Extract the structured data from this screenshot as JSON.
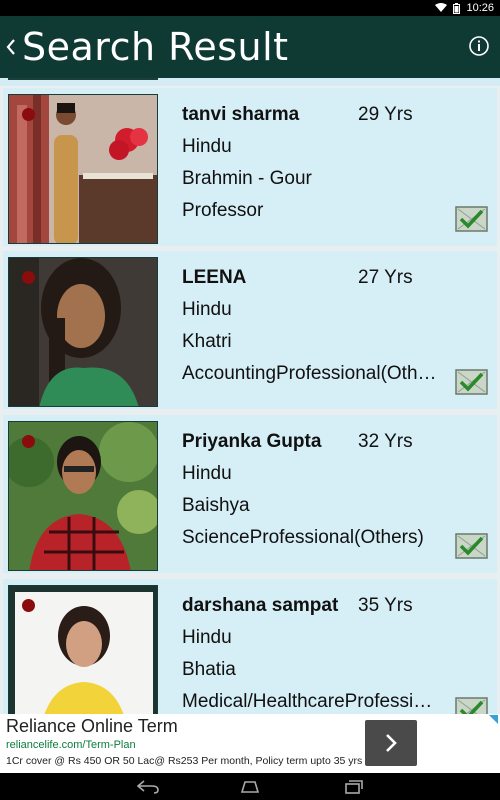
{
  "status_bar": {
    "time": "10:26",
    "icons": [
      "wifi-icon",
      "battery-icon"
    ]
  },
  "app_bar": {
    "back_icon": "chevron-left-icon",
    "title": "Search Result",
    "info_icon": "info-icon"
  },
  "results": [
    {
      "name": "tanvi sharma",
      "age": "29 Yrs",
      "religion": "Hindu",
      "caste": "Brahmin - Gour",
      "occupation": "Professor"
    },
    {
      "name": "LEENA",
      "age": "27 Yrs",
      "religion": "Hindu",
      "caste": "Khatri",
      "occupation": "AccountingProfessional(Others)"
    },
    {
      "name": "Priyanka Gupta",
      "age": "32 Yrs",
      "religion": "Hindu",
      "caste": "Baishya",
      "occupation": "ScienceProfessional(Others)"
    },
    {
      "name": "darshana sampat",
      "age": "35 Yrs",
      "religion": "Hindu",
      "caste": "Bhatia",
      "occupation": "Medical/HealthcareProfessional"
    }
  ],
  "ad": {
    "title": "Reliance Online Term",
    "url": "reliancelife.com/Term-Plan",
    "description": "1Cr cover @ Rs 450 OR 50 Lac@ Rs253 Per month, Policy term upto 35 yrs",
    "go_icon": "chevron-right-icon"
  },
  "nav_bar": {
    "icons": [
      "back-icon",
      "home-icon",
      "recent-apps-icon"
    ]
  },
  "colors": {
    "app_bar": "#0f3a33",
    "card_bg": "#d6eef6",
    "online_dot": "#8a0c0c"
  }
}
